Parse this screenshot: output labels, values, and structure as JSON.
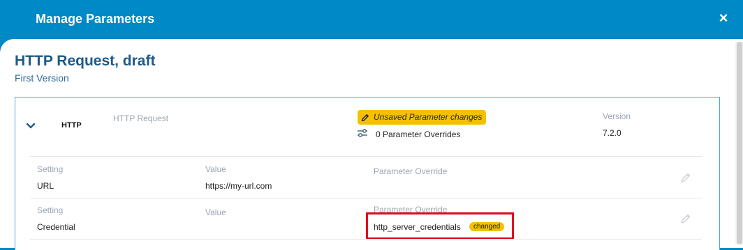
{
  "modal": {
    "title": "Manage Parameters",
    "close_icon": "×"
  },
  "page": {
    "title": "HTTP Request, draft",
    "subtitle": "First Version"
  },
  "component": {
    "name": "HTTP",
    "type": "HTTP Request",
    "status_badge": "Unsaved Parameter changes",
    "overrides_text": "0 Parameter Overrides",
    "version_label": "Version",
    "version_value": "7.2.0"
  },
  "settings": [
    {
      "setting_label": "Setting",
      "setting_value": "URL",
      "value_label": "Value",
      "value": "https://my-url.com",
      "override_label": "Parameter Override",
      "override_value": "",
      "override_badge": ""
    },
    {
      "setting_label": "Setting",
      "setting_value": "Credential",
      "value_label": "Value",
      "value": "",
      "override_label": "Parameter Override",
      "override_value": "http_server_credentials",
      "override_badge": "changed"
    }
  ],
  "colors": {
    "header": "#0089c7",
    "title": "#1d5a86",
    "badge": "#f5c000",
    "highlight": "#e3001b"
  }
}
